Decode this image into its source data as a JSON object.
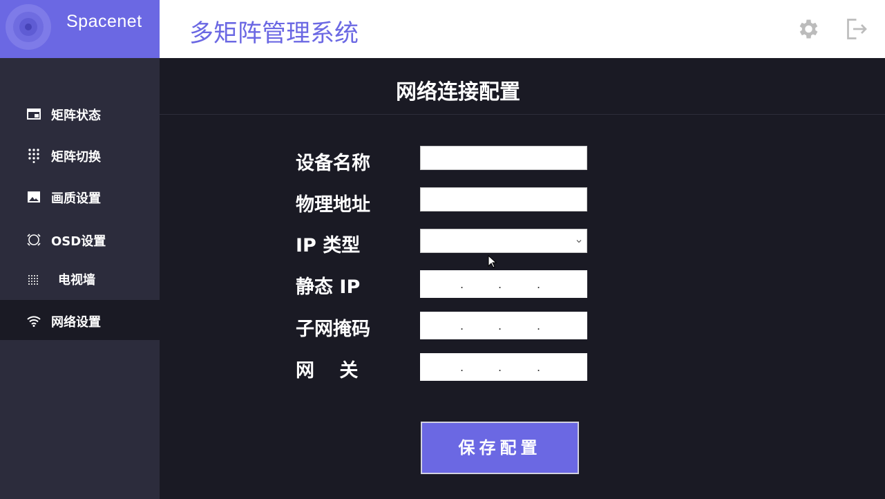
{
  "brand": {
    "name": "Spacenet"
  },
  "header": {
    "title": "多矩阵管理系统",
    "icons": [
      "gear-icon",
      "logout-icon"
    ]
  },
  "sidebar": {
    "items": [
      {
        "label": "矩阵状态",
        "icon": "window-icon",
        "active": false
      },
      {
        "label": "矩阵切换",
        "icon": "dot-grid-icon",
        "active": false
      },
      {
        "label": "画质设置",
        "icon": "image-icon",
        "active": false
      },
      {
        "label": "OSD设置",
        "icon": "osd-icon",
        "active": false
      },
      {
        "label": "电视墙",
        "icon": "led-grid-icon",
        "active": false
      },
      {
        "label": "网络设置",
        "icon": "wifi-icon",
        "active": true
      }
    ]
  },
  "main": {
    "title": "网络连接配置",
    "form": {
      "device_name": {
        "label": "设备名称",
        "value": ""
      },
      "mac_address": {
        "label": "物理地址",
        "value": ""
      },
      "ip_type": {
        "label": "IP 类型",
        "value": ""
      },
      "static_ip": {
        "label": "静态 IP",
        "dots": [
          ".",
          ".",
          "."
        ]
      },
      "subnet_mask": {
        "label": "子网掩码",
        "dots": [
          ".",
          ".",
          "."
        ]
      },
      "gateway": {
        "label": "网　 关",
        "dots": [
          ".",
          ".",
          "."
        ]
      }
    },
    "save_label": "保存配置"
  },
  "colors": {
    "accent": "#6b68e3",
    "sidebar_bg": "#2c2c3c",
    "main_bg": "#1a1a24",
    "header_bg": "#ffffff"
  }
}
